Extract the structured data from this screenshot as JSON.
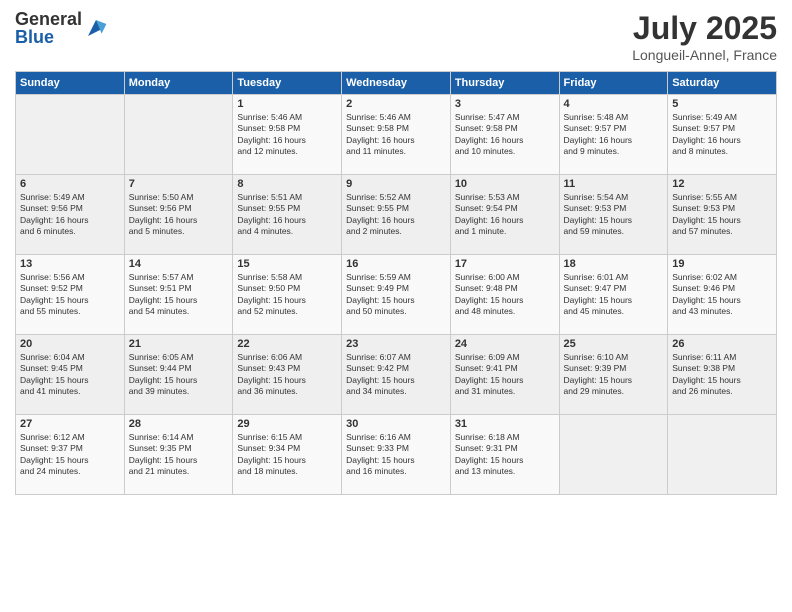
{
  "logo": {
    "general": "General",
    "blue": "Blue"
  },
  "header": {
    "month": "July 2025",
    "location": "Longueil-Annel, France"
  },
  "days_of_week": [
    "Sunday",
    "Monday",
    "Tuesday",
    "Wednesday",
    "Thursday",
    "Friday",
    "Saturday"
  ],
  "weeks": [
    [
      {
        "day": "",
        "info": ""
      },
      {
        "day": "",
        "info": ""
      },
      {
        "day": "1",
        "info": "Sunrise: 5:46 AM\nSunset: 9:58 PM\nDaylight: 16 hours\nand 12 minutes."
      },
      {
        "day": "2",
        "info": "Sunrise: 5:46 AM\nSunset: 9:58 PM\nDaylight: 16 hours\nand 11 minutes."
      },
      {
        "day": "3",
        "info": "Sunrise: 5:47 AM\nSunset: 9:58 PM\nDaylight: 16 hours\nand 10 minutes."
      },
      {
        "day": "4",
        "info": "Sunrise: 5:48 AM\nSunset: 9:57 PM\nDaylight: 16 hours\nand 9 minutes."
      },
      {
        "day": "5",
        "info": "Sunrise: 5:49 AM\nSunset: 9:57 PM\nDaylight: 16 hours\nand 8 minutes."
      }
    ],
    [
      {
        "day": "6",
        "info": "Sunrise: 5:49 AM\nSunset: 9:56 PM\nDaylight: 16 hours\nand 6 minutes."
      },
      {
        "day": "7",
        "info": "Sunrise: 5:50 AM\nSunset: 9:56 PM\nDaylight: 16 hours\nand 5 minutes."
      },
      {
        "day": "8",
        "info": "Sunrise: 5:51 AM\nSunset: 9:55 PM\nDaylight: 16 hours\nand 4 minutes."
      },
      {
        "day": "9",
        "info": "Sunrise: 5:52 AM\nSunset: 9:55 PM\nDaylight: 16 hours\nand 2 minutes."
      },
      {
        "day": "10",
        "info": "Sunrise: 5:53 AM\nSunset: 9:54 PM\nDaylight: 16 hours\nand 1 minute."
      },
      {
        "day": "11",
        "info": "Sunrise: 5:54 AM\nSunset: 9:53 PM\nDaylight: 15 hours\nand 59 minutes."
      },
      {
        "day": "12",
        "info": "Sunrise: 5:55 AM\nSunset: 9:53 PM\nDaylight: 15 hours\nand 57 minutes."
      }
    ],
    [
      {
        "day": "13",
        "info": "Sunrise: 5:56 AM\nSunset: 9:52 PM\nDaylight: 15 hours\nand 55 minutes."
      },
      {
        "day": "14",
        "info": "Sunrise: 5:57 AM\nSunset: 9:51 PM\nDaylight: 15 hours\nand 54 minutes."
      },
      {
        "day": "15",
        "info": "Sunrise: 5:58 AM\nSunset: 9:50 PM\nDaylight: 15 hours\nand 52 minutes."
      },
      {
        "day": "16",
        "info": "Sunrise: 5:59 AM\nSunset: 9:49 PM\nDaylight: 15 hours\nand 50 minutes."
      },
      {
        "day": "17",
        "info": "Sunrise: 6:00 AM\nSunset: 9:48 PM\nDaylight: 15 hours\nand 48 minutes."
      },
      {
        "day": "18",
        "info": "Sunrise: 6:01 AM\nSunset: 9:47 PM\nDaylight: 15 hours\nand 45 minutes."
      },
      {
        "day": "19",
        "info": "Sunrise: 6:02 AM\nSunset: 9:46 PM\nDaylight: 15 hours\nand 43 minutes."
      }
    ],
    [
      {
        "day": "20",
        "info": "Sunrise: 6:04 AM\nSunset: 9:45 PM\nDaylight: 15 hours\nand 41 minutes."
      },
      {
        "day": "21",
        "info": "Sunrise: 6:05 AM\nSunset: 9:44 PM\nDaylight: 15 hours\nand 39 minutes."
      },
      {
        "day": "22",
        "info": "Sunrise: 6:06 AM\nSunset: 9:43 PM\nDaylight: 15 hours\nand 36 minutes."
      },
      {
        "day": "23",
        "info": "Sunrise: 6:07 AM\nSunset: 9:42 PM\nDaylight: 15 hours\nand 34 minutes."
      },
      {
        "day": "24",
        "info": "Sunrise: 6:09 AM\nSunset: 9:41 PM\nDaylight: 15 hours\nand 31 minutes."
      },
      {
        "day": "25",
        "info": "Sunrise: 6:10 AM\nSunset: 9:39 PM\nDaylight: 15 hours\nand 29 minutes."
      },
      {
        "day": "26",
        "info": "Sunrise: 6:11 AM\nSunset: 9:38 PM\nDaylight: 15 hours\nand 26 minutes."
      }
    ],
    [
      {
        "day": "27",
        "info": "Sunrise: 6:12 AM\nSunset: 9:37 PM\nDaylight: 15 hours\nand 24 minutes."
      },
      {
        "day": "28",
        "info": "Sunrise: 6:14 AM\nSunset: 9:35 PM\nDaylight: 15 hours\nand 21 minutes."
      },
      {
        "day": "29",
        "info": "Sunrise: 6:15 AM\nSunset: 9:34 PM\nDaylight: 15 hours\nand 18 minutes."
      },
      {
        "day": "30",
        "info": "Sunrise: 6:16 AM\nSunset: 9:33 PM\nDaylight: 15 hours\nand 16 minutes."
      },
      {
        "day": "31",
        "info": "Sunrise: 6:18 AM\nSunset: 9:31 PM\nDaylight: 15 hours\nand 13 minutes."
      },
      {
        "day": "",
        "info": ""
      },
      {
        "day": "",
        "info": ""
      }
    ]
  ]
}
